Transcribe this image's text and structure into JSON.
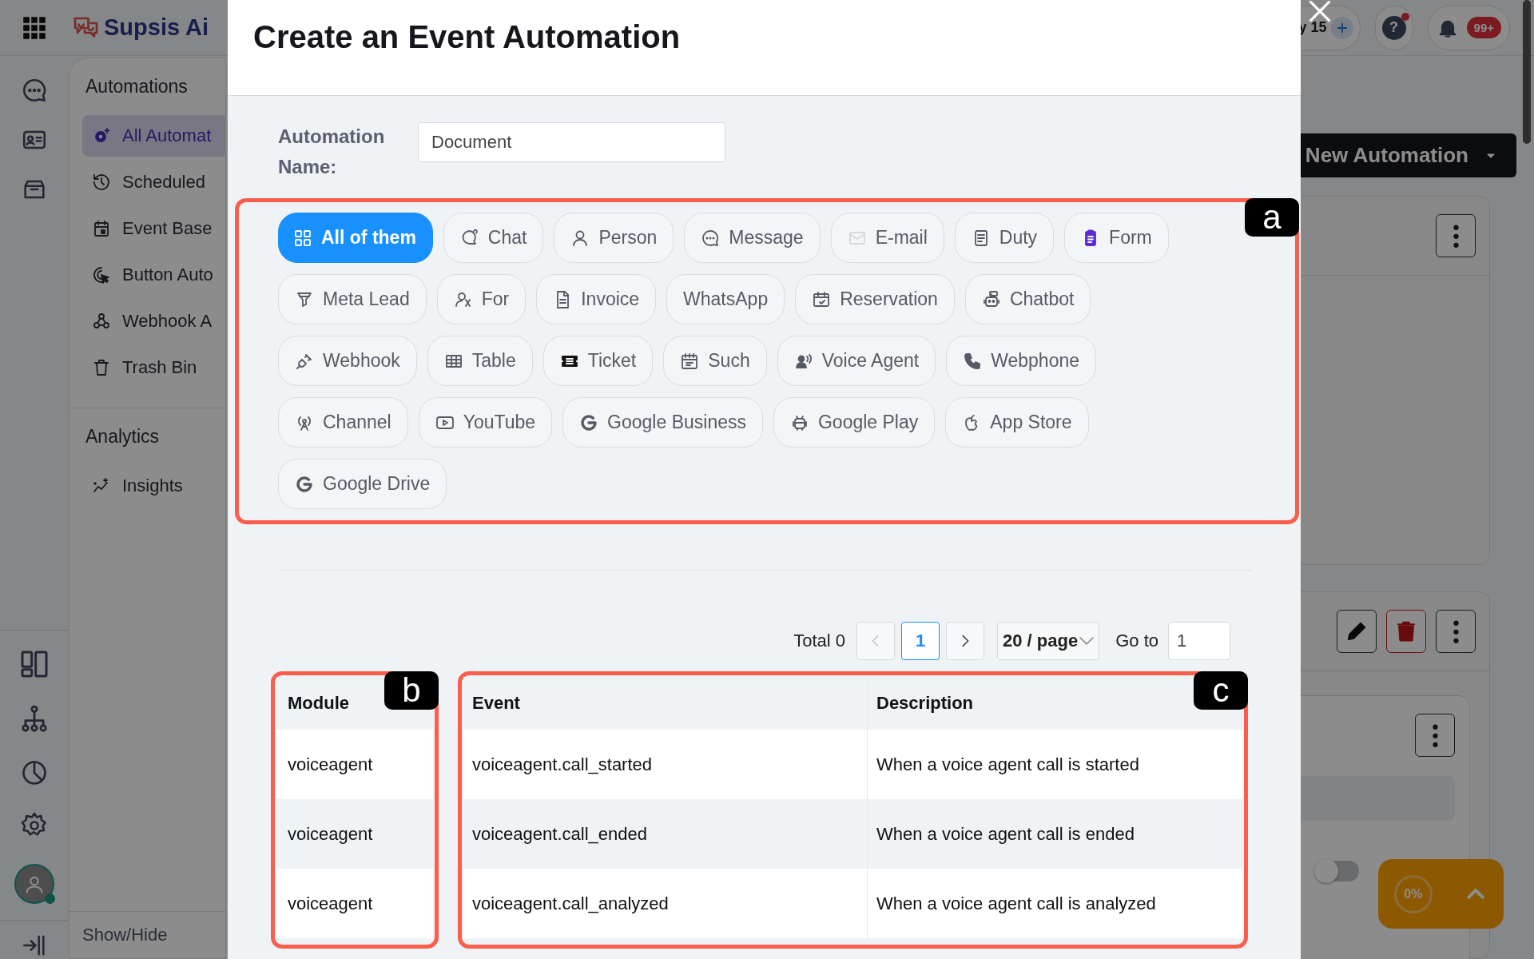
{
  "app": {
    "logo": "Supsis Ai",
    "counter": "y 15",
    "help": "?",
    "notification_count": "99+"
  },
  "nav": {
    "sections": [
      {
        "title": "Automations",
        "items": [
          {
            "label": "All Automat",
            "selected": true
          },
          {
            "label": "Scheduled",
            "selected": false
          },
          {
            "label": "Event Base",
            "selected": false
          },
          {
            "label": "Button Auto",
            "selected": false
          },
          {
            "label": "Webhook A",
            "selected": false
          },
          {
            "label": "Trash Bin",
            "selected": false
          }
        ]
      },
      {
        "title": "Analytics",
        "items": [
          {
            "label": "Insights",
            "selected": false
          }
        ]
      }
    ],
    "footer": "Show/Hide"
  },
  "main": {
    "new_button": "New Automation",
    "toggle": {
      "on": false
    },
    "progress": {
      "reading": "0%"
    }
  },
  "modal": {
    "title": "Create an Event Automation",
    "name_label": "Automation Name:",
    "name_value": "Document",
    "filters": [
      {
        "label": "All of them",
        "selected": true
      },
      {
        "label": "Chat",
        "selected": false
      },
      {
        "label": "Person",
        "selected": false
      },
      {
        "label": "Message",
        "selected": false
      },
      {
        "label": "E-mail",
        "selected": false
      },
      {
        "label": "Duty",
        "selected": false
      },
      {
        "label": "Form",
        "selected": false
      },
      {
        "label": "Meta Lead",
        "selected": false
      },
      {
        "label": "For",
        "selected": false
      },
      {
        "label": "Invoice",
        "selected": false
      },
      {
        "label": "WhatsApp",
        "selected": false
      },
      {
        "label": "Reservation",
        "selected": false
      },
      {
        "label": "Chatbot",
        "selected": false
      },
      {
        "label": "Webhook",
        "selected": false
      },
      {
        "label": "Table",
        "selected": false
      },
      {
        "label": "Ticket",
        "selected": false
      },
      {
        "label": "Such",
        "selected": false
      },
      {
        "label": "Voice Agent",
        "selected": false
      },
      {
        "label": "Webphone",
        "selected": false
      },
      {
        "label": "Channel",
        "selected": false
      },
      {
        "label": "YouTube",
        "selected": false
      },
      {
        "label": "Google Business",
        "selected": false
      },
      {
        "label": "Google Play",
        "selected": false
      },
      {
        "label": "App Store",
        "selected": false
      },
      {
        "label": "Google Drive",
        "selected": false
      }
    ],
    "pagination": {
      "total": "Total 0",
      "prev": {
        "disabled": true
      },
      "pages": [
        {
          "label": "1",
          "selected": true
        }
      ],
      "next": {
        "disabled": false
      },
      "page_size": "20 / page",
      "goto_label": "Go to",
      "goto_value": "1"
    },
    "table": {
      "columns": [
        "Module",
        "Event",
        "Description"
      ],
      "rows": [
        [
          "voiceagent",
          "voiceagent.call_started",
          "When a voice agent call is started"
        ],
        [
          "voiceagent",
          "voiceagent.call_ended",
          "When a voice agent call is ended"
        ],
        [
          "voiceagent",
          "voiceagent.call_analyzed",
          "When a voice agent call is analyzed"
        ]
      ]
    }
  },
  "annotations": [
    {
      "label": "a"
    },
    {
      "label": "b"
    },
    {
      "label": "c"
    }
  ]
}
